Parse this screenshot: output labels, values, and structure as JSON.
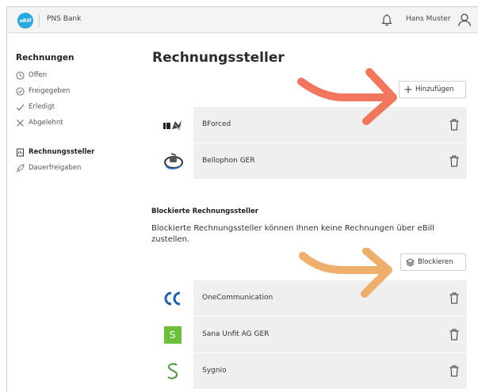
{
  "header": {
    "logo_text": "eBill",
    "bank_name": "PNS Bank",
    "user_name": "Hans Muster"
  },
  "sidebar": {
    "section_title": "Rechnungen",
    "items": [
      {
        "label": "Offen",
        "icon": "clock-icon"
      },
      {
        "label": "Freigegeben",
        "icon": "clock-check-icon"
      },
      {
        "label": "Erledigt",
        "icon": "check-icon"
      },
      {
        "label": "Abgelehnt",
        "icon": "x-icon"
      }
    ],
    "items2": [
      {
        "label": "Rechnungssteller",
        "icon": "document-icon",
        "active": true
      },
      {
        "label": "Dauerfreigaben",
        "icon": "rocket-icon"
      }
    ]
  },
  "main": {
    "title": "Rechnungssteller",
    "add_button": "Hinzufügen",
    "billers": [
      {
        "name": "BForced",
        "logo": "bforced-logo"
      },
      {
        "name": "Bellophon GER",
        "logo": "bellophon-logo"
      }
    ],
    "blocked": {
      "title": "Blockierte Rechnungssteller",
      "description": "Blockierte Rechnungssteller können Ihnen keine Rechnungen über eBill zustellen.",
      "block_button": "Blockieren",
      "billers": [
        {
          "name": "OneCommunication",
          "logo": "onecommunication-logo"
        },
        {
          "name": "Sana Unfit AG GER",
          "logo": "sana-logo",
          "logo_text": "S"
        },
        {
          "name": "Sygnio",
          "logo": "sygnio-logo",
          "logo_text": "S"
        }
      ]
    }
  },
  "colors": {
    "accent_blue": "#2aa9e0",
    "arrow_red": "#f0775d",
    "arrow_orange": "#eeae6c",
    "sana_green": "#6cbf3c",
    "sygnio_green": "#5a9a4a"
  }
}
